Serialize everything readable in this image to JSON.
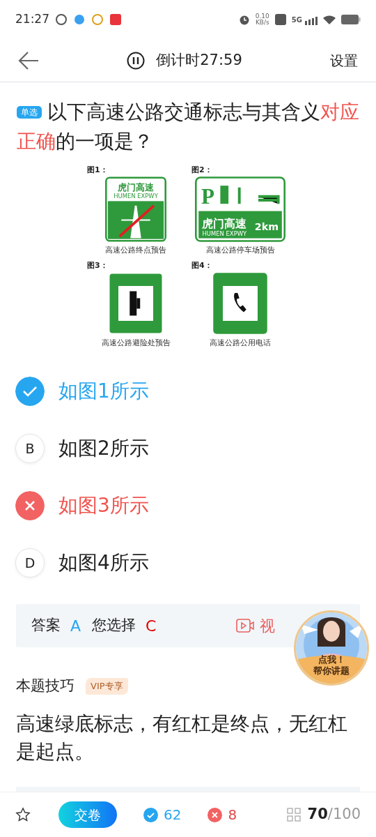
{
  "status_bar": {
    "time": "21:27",
    "net_speed": "0.10",
    "net_unit": "KB/s",
    "network": "5G"
  },
  "header": {
    "countdown": "倒计时27:59",
    "settings": "设置"
  },
  "question": {
    "type_tag": "单选",
    "text": "以下高速公路交通标志与其含义**对应正确**的一项是？"
  },
  "figure": {
    "panels": [
      {
        "label": "图1：",
        "caption": "高速公路终点预告",
        "kind": "end",
        "sign_title": "虎门高速",
        "sign_sub": "HUMEN EXPWY"
      },
      {
        "label": "图2：",
        "caption": "高速公路停车场预告",
        "kind": "parking",
        "sign_title": "虎门高速",
        "sign_sub": "HUMEN EXPWY",
        "sign_distance": "2km",
        "sign_letter": "P"
      },
      {
        "label": "图3：",
        "caption": "高速公路避险处预告",
        "kind": "escape"
      },
      {
        "label": "图4：",
        "caption": "高速公路公用电话",
        "kind": "phone"
      }
    ]
  },
  "options": [
    {
      "text": "如图1所示",
      "kind": "correct"
    },
    {
      "letter": "B",
      "text": "如图2所示",
      "kind": "plain"
    },
    {
      "text": "如图3所示",
      "kind": "wrong"
    },
    {
      "letter": "D",
      "text": "如图4所示",
      "kind": "plain"
    }
  ],
  "answer": {
    "label": "答案",
    "correct": "A",
    "chosen_label": "您选择",
    "chosen": "C",
    "video": "视"
  },
  "tutor_badge": {
    "line1": "点我！",
    "line2": "帮你讲题"
  },
  "tip": {
    "title": "本题技巧",
    "tag": "VIP专享",
    "text": "高速绿底标志，有红杠是终点，无红杠是起点。"
  },
  "bottom_bar": {
    "submit": "交卷",
    "correct_count": "62",
    "wrong_count": "8",
    "current": "70",
    "total": "/100"
  }
}
